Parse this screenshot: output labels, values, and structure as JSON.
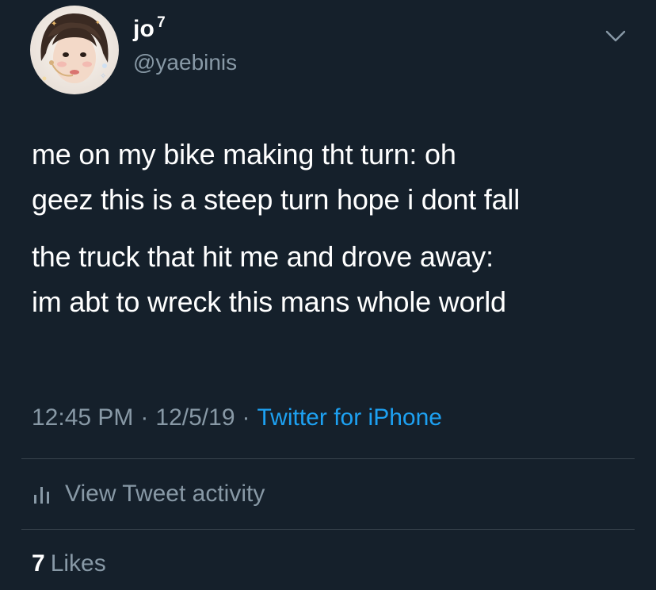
{
  "colors": {
    "background": "#15202b",
    "primary_text": "#ffffff",
    "secondary_text": "#8899a6",
    "link": "#1da1f2",
    "divider": "#38444d"
  },
  "author": {
    "display_name": "jo",
    "display_name_sup": "7",
    "handle": "@yaebinis",
    "avatar_icon": "profile-photo"
  },
  "menu": {
    "icon": "chevron-down-icon"
  },
  "tweet": {
    "paragraph_1": "me on my bike making tht turn: oh\ngeez this is a steep turn hope i dont fall",
    "paragraph_2": "the truck that hit me and drove away:\nim abt to wreck this mans whole world"
  },
  "meta": {
    "time": "12:45 PM",
    "separator_1": "·",
    "date": "12/5/19",
    "separator_2": "·",
    "source": "Twitter for iPhone"
  },
  "activity": {
    "icon": "bar-chart-icon",
    "label": "View Tweet activity"
  },
  "likes": {
    "count": "7",
    "label": "Likes"
  }
}
